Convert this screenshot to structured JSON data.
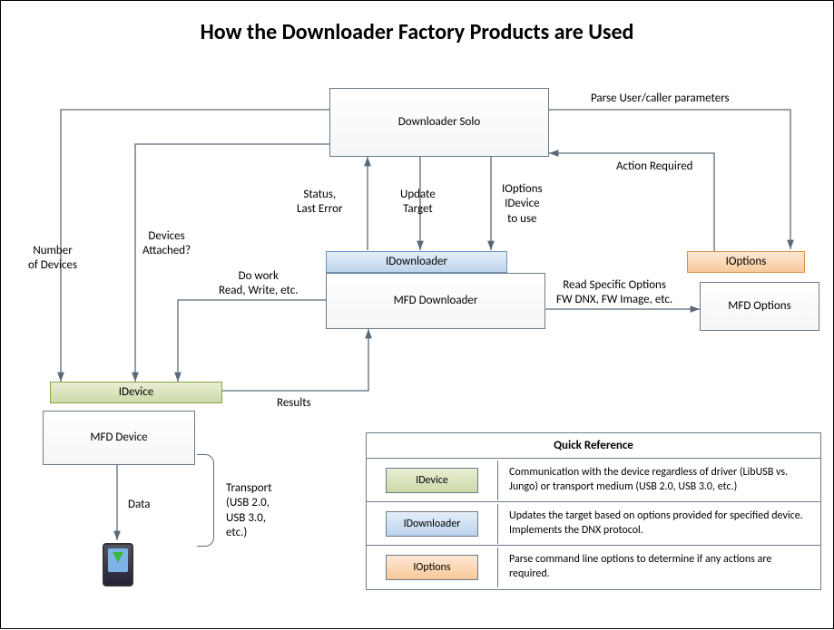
{
  "title": "How the Downloader Factory Products are Used",
  "boxes": {
    "downloader_solo": "Downloader Solo",
    "idownloader": "IDownloader",
    "mfd_downloader": "MFD Downloader",
    "ioptions": "IOptions",
    "mfd_options": "MFD Options",
    "idevice": "IDevice",
    "mfd_device": "MFD Device"
  },
  "labels": {
    "parse_user": "Parse User/caller parameters",
    "action_required": "Action Required",
    "status_last_error": "Status,\nLast Error",
    "update_target": "Update\nTarget",
    "ioptions_idevice": "IOptions\nIDevice\nto use",
    "number_of_devices": "Number\nof Devices",
    "devices_attached": "Devices\nAttached?",
    "do_work": "Do work\nRead, Write, etc.",
    "read_specific": "Read Specific Options\nFW DNX, FW Image, etc.",
    "results": "Results",
    "data": "Data",
    "transport": "Transport\n(USB 2.0,\nUSB 3.0,\netc.)"
  },
  "legend": {
    "title": "Quick Reference",
    "rows": [
      {
        "key": "IDevice",
        "cls": "green",
        "desc": "Communication with the device regardless of driver (LibUSB vs. Jungo) or transport medium (USB 2.0, USB 3.0, etc.)"
      },
      {
        "key": "IDownloader",
        "cls": "blue",
        "desc": "Updates the target based on options provided for specified device. Implements the DNX protocol."
      },
      {
        "key": "IOptions",
        "cls": "orange",
        "desc": "Parse command line options to determine if any actions are required."
      }
    ]
  }
}
